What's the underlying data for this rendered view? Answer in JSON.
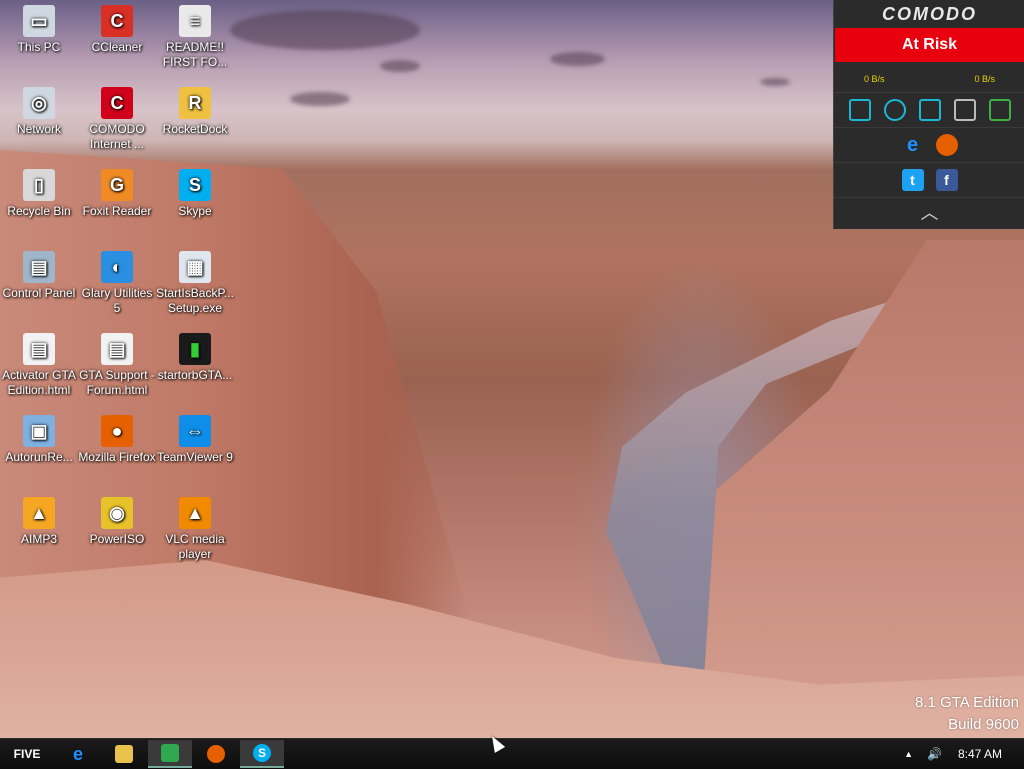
{
  "desktop": {
    "icons": [
      {
        "label": "This PC",
        "icon": "computer-icon",
        "color": "#cfd8e0"
      },
      {
        "label": "CCleaner",
        "icon": "ccleaner-icon",
        "color": "#d93025"
      },
      {
        "label": "README!! FIRST FO...",
        "icon": "document-icon",
        "color": "#e9e9e9"
      },
      {
        "label": "Network",
        "icon": "network-icon",
        "color": "#cfd8e0"
      },
      {
        "label": "COMODO Internet ...",
        "icon": "comodo-icon",
        "color": "#d0021b"
      },
      {
        "label": "RocketDock",
        "icon": "rocketdock-icon",
        "color": "#f0c040"
      },
      {
        "label": "Recycle Bin",
        "icon": "recycle-bin-icon",
        "color": "#d8d8d8"
      },
      {
        "label": "Foxit Reader",
        "icon": "foxit-icon",
        "color": "#f08a24"
      },
      {
        "label": "Skype",
        "icon": "skype-icon",
        "color": "#00aff0"
      },
      {
        "label": "Control Panel",
        "icon": "control-panel-icon",
        "color": "#9fb6c8"
      },
      {
        "label": "Glary Utilities 5",
        "icon": "glary-icon",
        "color": "#2a8fe0"
      },
      {
        "label": "StartIsBackP... Setup.exe",
        "icon": "installer-icon",
        "color": "#dfe6ef"
      },
      {
        "label": "Activator GTA Edition.html",
        "icon": "html-file-icon",
        "color": "#f2f2f2"
      },
      {
        "label": "GTA Support - Forum.html",
        "icon": "html-file-icon",
        "color": "#f2f2f2"
      },
      {
        "label": "startorbGTA...",
        "icon": "image-file-icon",
        "color": "#1a1a1a"
      },
      {
        "label": "AutorunRe...",
        "icon": "autorun-icon",
        "color": "#7fb0e0"
      },
      {
        "label": "Mozilla Firefox",
        "icon": "firefox-icon",
        "color": "#e66000"
      },
      {
        "label": "TeamViewer 9",
        "icon": "teamviewer-icon",
        "color": "#0e8ee9"
      },
      {
        "label": "AIMP3",
        "icon": "aimp-icon",
        "color": "#f5a623"
      },
      {
        "label": "PowerISO",
        "icon": "poweriso-icon",
        "color": "#e8c22a"
      },
      {
        "label": "VLC media player",
        "icon": "vlc-icon",
        "color": "#f18a00"
      }
    ]
  },
  "comodo_widget": {
    "brand": "COMODO",
    "status": "At Risk",
    "status_color": "#e8000f",
    "download_speed": "0 B/s",
    "upload_speed": "0 B/s",
    "tools": [
      "tasks-icon",
      "sync-icon",
      "dashboard-icon",
      "sandbox-icon",
      "virtual-desktop-icon"
    ],
    "browsers": [
      "internet-explorer-icon",
      "firefox-icon"
    ],
    "social": [
      "twitter-icon",
      "facebook-icon"
    ]
  },
  "watermark": {
    "line1": "8.1 GTA Edition",
    "line2": "Build 9600"
  },
  "taskbar": {
    "start_label": "FIVE",
    "pinned": [
      "internet-explorer-icon",
      "file-explorer-icon",
      "store-icon",
      "firefox-icon",
      "skype-icon"
    ],
    "clock": "8:47 AM"
  }
}
